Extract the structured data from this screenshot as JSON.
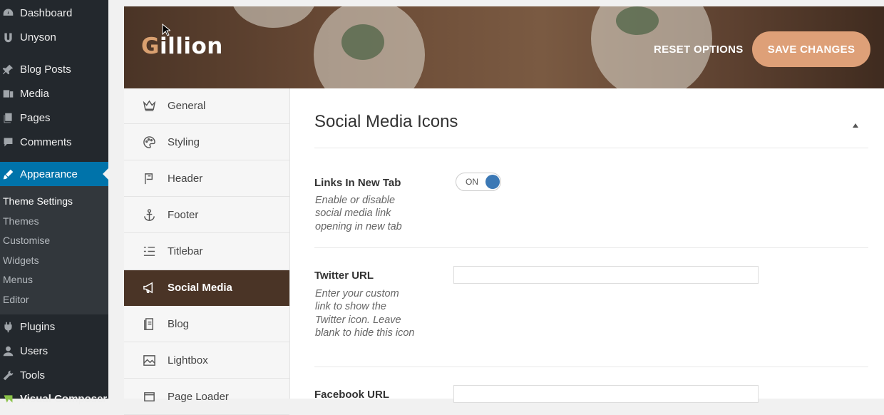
{
  "wp_menu": {
    "dashboard": "Dashboard",
    "unyson": "Unyson",
    "blog_posts": "Blog Posts",
    "media": "Media",
    "pages": "Pages",
    "comments": "Comments",
    "appearance": "Appearance",
    "submenu": [
      "Theme Settings",
      "Themes",
      "Customise",
      "Widgets",
      "Menus",
      "Editor"
    ],
    "plugins": "Plugins",
    "users": "Users",
    "tools": "Tools",
    "visual_composer": "Visual Composer"
  },
  "header": {
    "logo_g": "G",
    "logo_rest": "illion",
    "reset_label": "RESET OPTIONS",
    "save_label": "SAVE CHANGES"
  },
  "tabs": [
    "General",
    "Styling",
    "Header",
    "Footer",
    "Titlebar",
    "Social Media",
    "Blog",
    "Lightbox",
    "Page Loader"
  ],
  "active_tab": "Social Media",
  "section": {
    "title": "Social Media Icons",
    "links_new_tab": {
      "label": "Links In New Tab",
      "desc": "Enable or disable social media link opening in new tab",
      "toggle_text": "ON"
    },
    "twitter": {
      "label": "Twitter URL",
      "desc": "Enter your custom link to show the Twitter icon. Leave blank to hide this icon",
      "value": ""
    },
    "facebook": {
      "label": "Facebook URL",
      "value": ""
    }
  },
  "colors": {
    "accent": "#dea078",
    "active_tab": "#4a3426",
    "wp_highlight": "#0073aa",
    "toggle_on": "#3b78b5"
  }
}
